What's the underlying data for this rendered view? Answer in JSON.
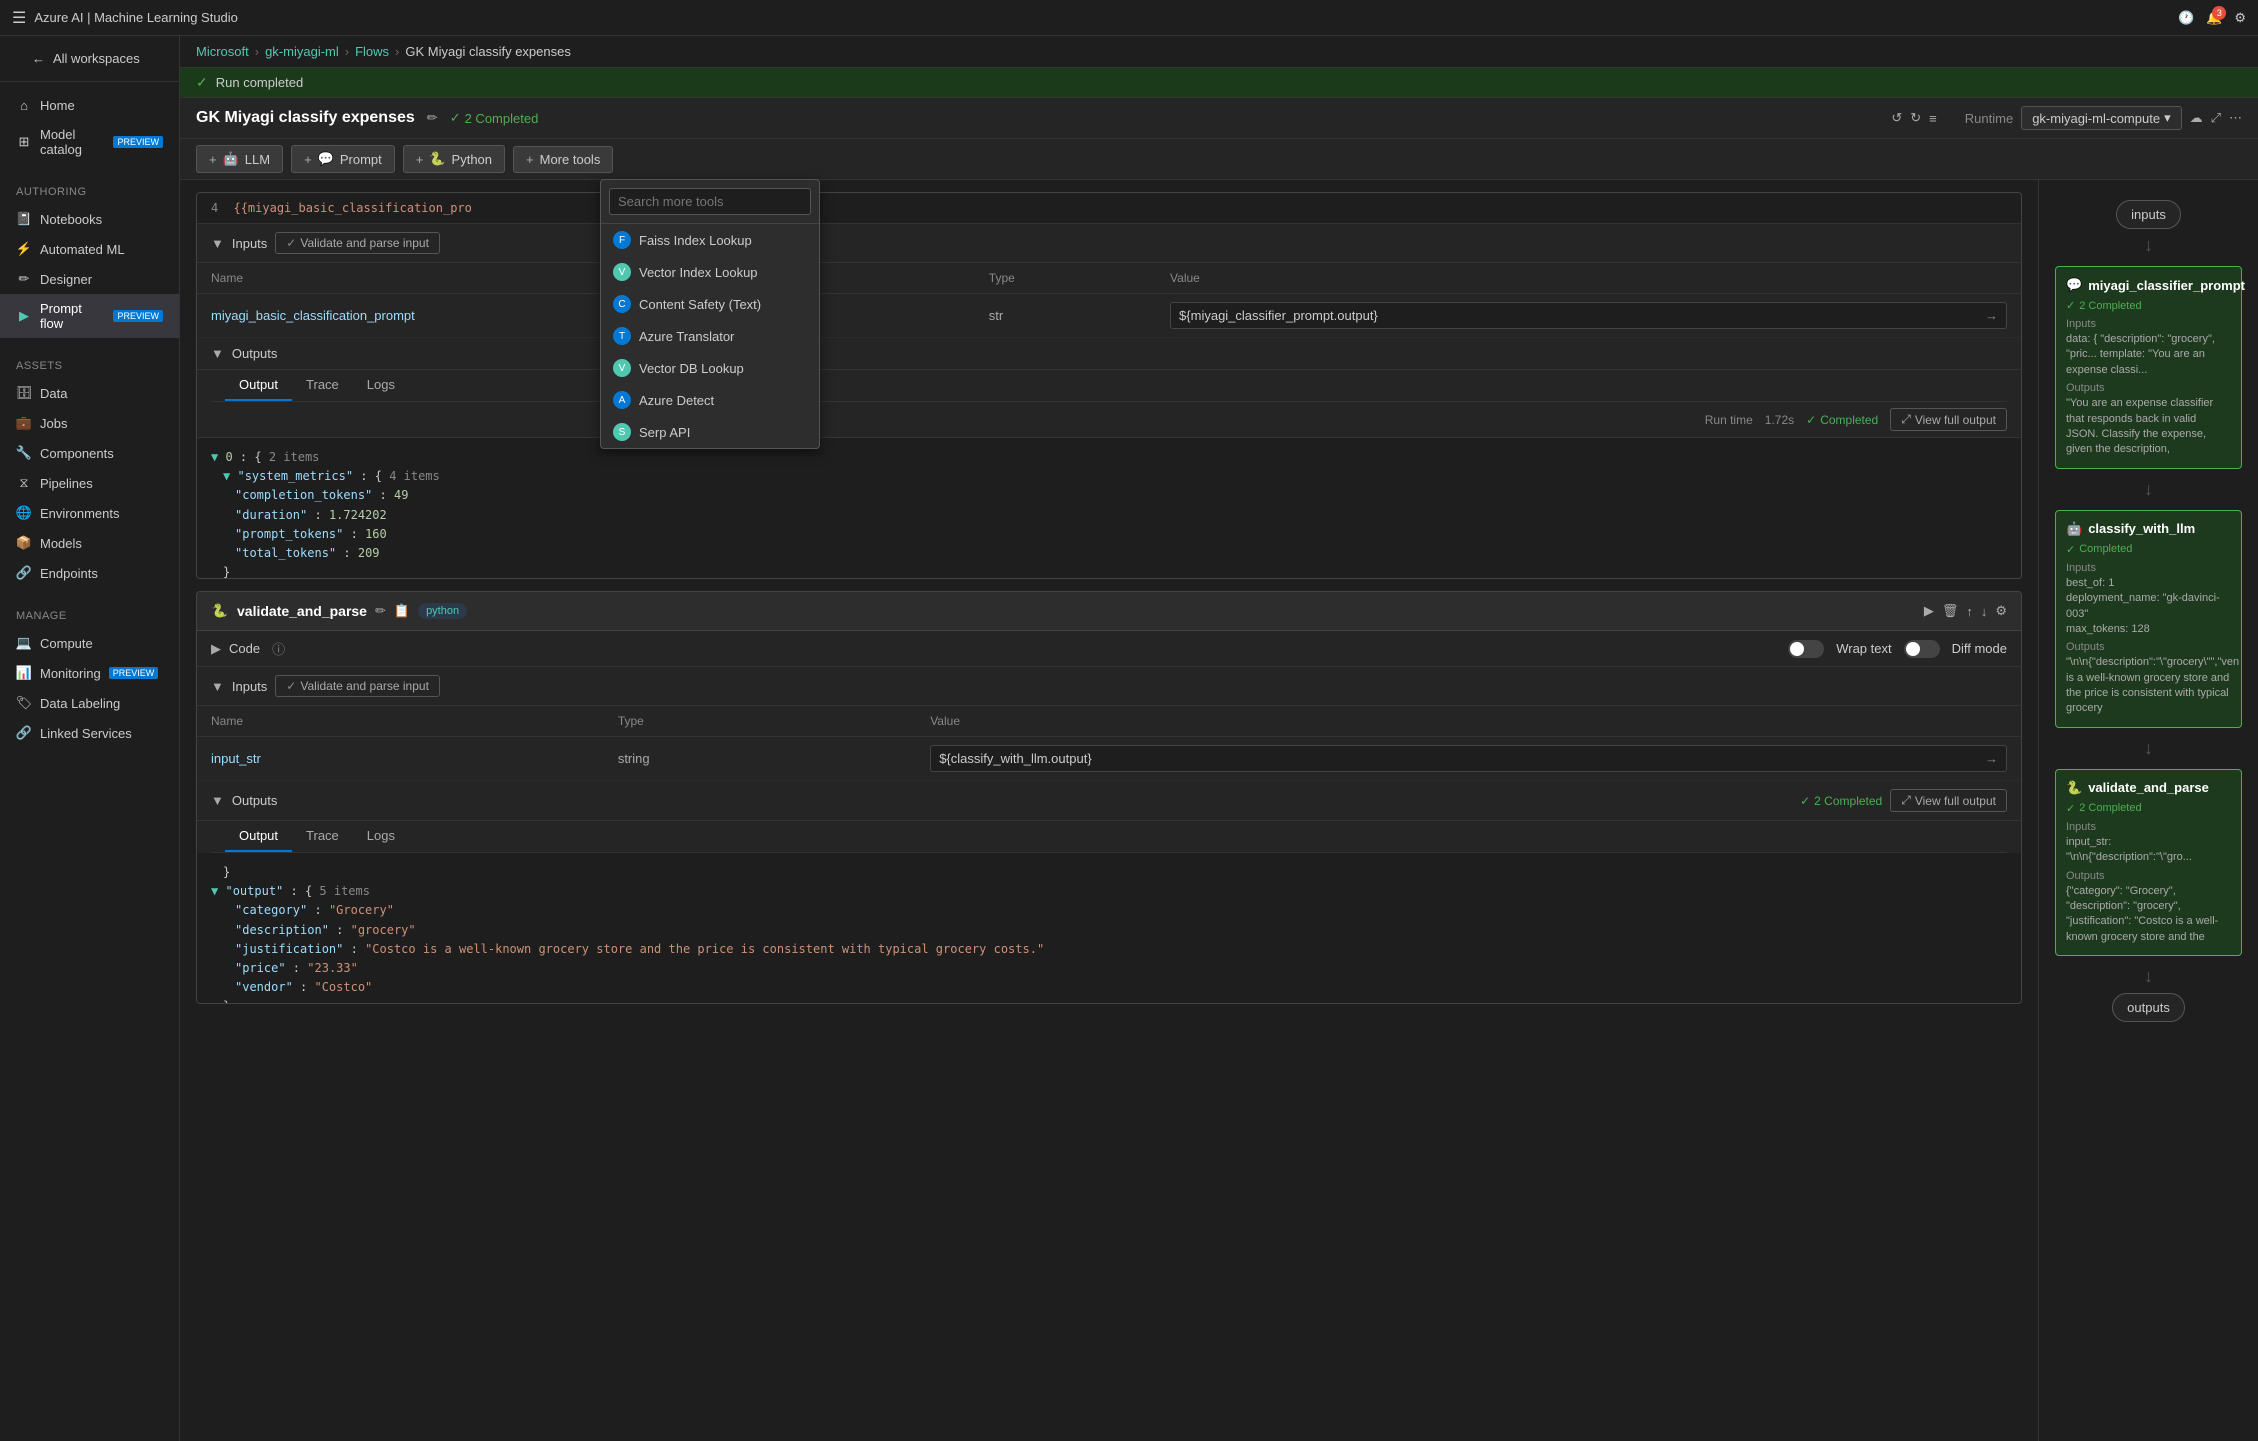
{
  "app": {
    "title": "Azure AI | Machine Learning Studio"
  },
  "breadcrumb": {
    "items": [
      "Microsoft",
      "gk-miyagi-ml",
      "Flows",
      "GK Miyagi classify expenses"
    ]
  },
  "status": {
    "run_completed": "Run completed"
  },
  "flow": {
    "title": "GK Miyagi classify expenses",
    "completed_count": "2 Completed",
    "runtime_label": "Runtime",
    "runtime_value": "gk-miyagi-ml-compute"
  },
  "toolbar": {
    "llm_label": "LLM",
    "prompt_label": "Prompt",
    "python_label": "Python",
    "more_tools_label": "More tools"
  },
  "dropdown": {
    "search_placeholder": "Search more tools",
    "items": [
      {
        "id": "faiss",
        "label": "Faiss Index Lookup",
        "color": "#0078d4"
      },
      {
        "id": "vector",
        "label": "Vector Index Lookup",
        "color": "#4ec9b0"
      },
      {
        "id": "content_safety",
        "label": "Content Safety (Text)",
        "color": "#0078d4"
      },
      {
        "id": "translator",
        "label": "Azure Translator",
        "color": "#0078d4"
      },
      {
        "id": "vector_db",
        "label": "Vector DB Lookup",
        "color": "#4ec9b0"
      },
      {
        "id": "azure_detect",
        "label": "Azure Detect",
        "color": "#0078d4"
      },
      {
        "id": "serp",
        "label": "Serp API",
        "color": "#4ec9b0"
      }
    ]
  },
  "node1": {
    "code_snippet": "{{miyagi_basic_classification_pro",
    "inputs_section": "Inputs",
    "validate_btn": "Validate and parse input",
    "table_headers": [
      "Name",
      "Type",
      "Value"
    ],
    "input_row": {
      "name": "miyagi_basic_classification_prompt",
      "type": "str",
      "value": "${miyagi_classifier_prompt.output}"
    },
    "outputs_section": "Outputs",
    "output_tabs": [
      "Output",
      "Trace",
      "Logs"
    ],
    "runtime_label": "Run time",
    "runtime_value": "1.72s",
    "completed_label": "Completed",
    "view_full_output": "View full output",
    "output_data": {
      "line0": "▼ 0 : {  2 items",
      "line1": "  ▼ \"system_metrics\" : {  4 items",
      "line2": "    \"completion_tokens\" : 49",
      "line3": "    \"duration\" : 1.724202",
      "line4": "    \"prompt_tokens\" : 160",
      "line5": "    \"total_tokens\" : 209",
      "line6": "  }"
    }
  },
  "node2": {
    "title": "validate_and_parse",
    "tag": "python",
    "code_label": "Code",
    "wrap_text": "Wrap text",
    "diff_mode": "Diff mode",
    "inputs_section": "Inputs",
    "validate_btn": "Validate and parse input",
    "table_headers": [
      "Name",
      "Type",
      "Value"
    ],
    "input_row": {
      "name": "input_str",
      "type": "string",
      "value": "${classify_with_llm.output}"
    },
    "outputs_section": "Outputs",
    "completed_label": "2 Completed",
    "view_full_output": "View full output",
    "output_tabs": [
      "Output",
      "Trace",
      "Logs"
    ],
    "output_data": {
      "line0": "  }",
      "line1": "  ▼ \"output\" : {  5 items",
      "line2": "    \"category\" : \"Grocery\"",
      "line3": "    \"description\" : \"grocery\"",
      "line4": "    \"justification\" : \"Costco is a well-known grocery store and the price is consistent with typical grocery costs.\"",
      "line5": "    \"price\" : \"23.33\"",
      "line6": "    \"vendor\" : \"Costco\"",
      "line7": "  }"
    }
  },
  "sidebar": {
    "items": [
      {
        "id": "home",
        "label": "Home",
        "icon": "⌂"
      },
      {
        "id": "model-catalog",
        "label": "Model catalog",
        "icon": "⊞",
        "preview": true
      },
      {
        "id": "authoring-header",
        "label": "Authoring",
        "is_header": true
      },
      {
        "id": "notebooks",
        "label": "Notebooks",
        "icon": "📓"
      },
      {
        "id": "automated-ml",
        "label": "Automated ML",
        "icon": "⚡"
      },
      {
        "id": "designer",
        "label": "Designer",
        "icon": "✏"
      },
      {
        "id": "prompt-flow",
        "label": "Prompt flow",
        "icon": "▶",
        "preview": true,
        "active": true
      },
      {
        "id": "assets-header",
        "label": "Assets",
        "is_header": true
      },
      {
        "id": "data",
        "label": "Data",
        "icon": "🗄"
      },
      {
        "id": "jobs",
        "label": "Jobs",
        "icon": "💼"
      },
      {
        "id": "components",
        "label": "Components",
        "icon": "🔧"
      },
      {
        "id": "pipelines",
        "label": "Pipelines",
        "icon": "⧖"
      },
      {
        "id": "environments",
        "label": "Environments",
        "icon": "🌐"
      },
      {
        "id": "models",
        "label": "Models",
        "icon": "📦"
      },
      {
        "id": "endpoints",
        "label": "Endpoints",
        "icon": "🔗"
      },
      {
        "id": "manage-header",
        "label": "Manage",
        "is_header": true
      },
      {
        "id": "compute",
        "label": "Compute",
        "icon": "💻"
      },
      {
        "id": "monitoring",
        "label": "Monitoring",
        "icon": "📊",
        "preview": true
      },
      {
        "id": "data-labeling",
        "label": "Data Labeling",
        "icon": "🏷"
      },
      {
        "id": "linked-services",
        "label": "Linked Services",
        "icon": "🔗"
      }
    ]
  },
  "right_panel": {
    "inputs_node": {
      "label": "inputs"
    },
    "miyagi_node": {
      "title": "miyagi_classifier_prompt",
      "status": "2 Completed",
      "inputs_label": "Inputs",
      "inputs_content": "data: { \"description\": \"grocery\", \"pric... template: \"You are an expense classi...",
      "outputs_label": "Outputs",
      "outputs_content": "\"You are an expense classifier that responds back in valid JSON. Classify the expense, given the description,"
    },
    "classify_node": {
      "title": "classify_with_llm",
      "status": "Completed",
      "inputs_label": "Inputs",
      "inputs_content": "best_of: 1\ndeployment_name: \"gk-davinci-003\"\nmax_tokens: 128",
      "outputs_label": "Outputs",
      "outputs_content": "\"\\n\\n{\"description\":\"\\\"grocery\\\"\",\"ven is a well-known grocery store and the price is consistent with typical grocery"
    },
    "validate_node": {
      "title": "validate_and_parse",
      "status": "2 Completed",
      "inputs_label": "Inputs",
      "inputs_content": "input_str: \"\\n\\n{\"description\":\"\\\"gro...",
      "outputs_label": "Outputs",
      "outputs_content": "{\"category\": \"Grocery\", \"description\": \"grocery\", \"justification\": \"Costco is a well-known grocery store and the"
    },
    "outputs_node": {
      "label": "outputs"
    }
  }
}
